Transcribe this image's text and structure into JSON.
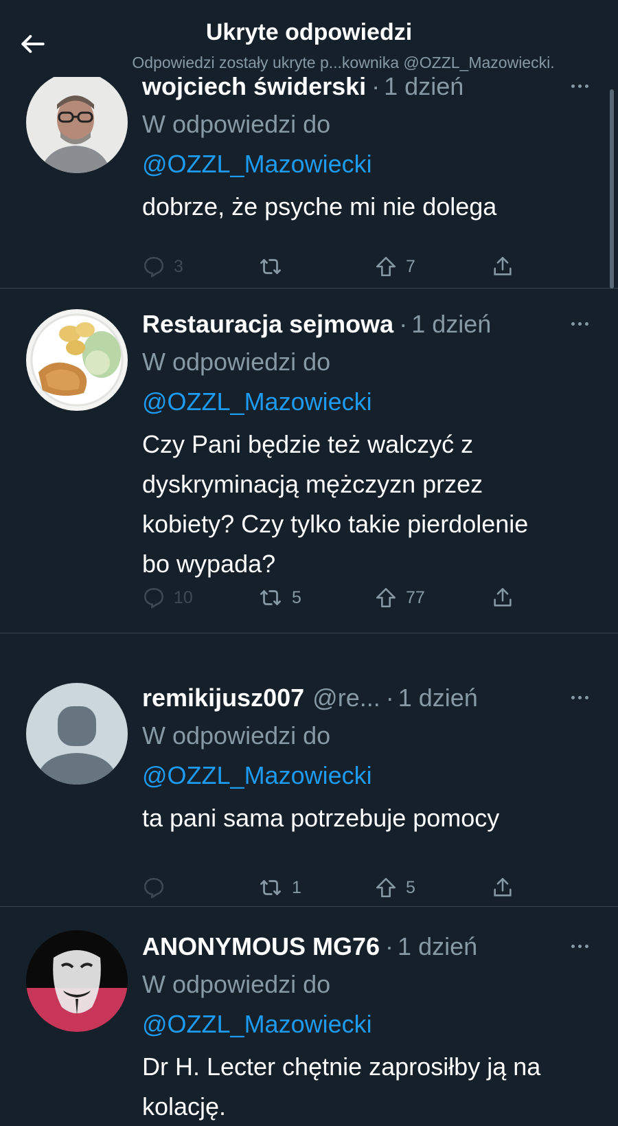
{
  "header": {
    "title": "Ukryte odpowiedzi",
    "subtitle": "Odpowiedzi zostały ukryte p...kownika @OZZL_Mazowiecki."
  },
  "tweets": [
    {
      "name": "wojciech świderski",
      "handle": "",
      "time": "1 dzień",
      "reply_label": "W odpowiedzi do",
      "reply_to": "@OZZL_Mazowiecki",
      "text": "dobrze, że psyche mi nie dolega",
      "replies": "3",
      "retweets": "",
      "likes": "7",
      "avatar_icon": "person-glasses-avatar"
    },
    {
      "name": "Restauracja sejmowa",
      "handle": "",
      "time": "1 dzień",
      "reply_label": "W odpowiedzi do",
      "reply_to": "@OZZL_Mazowiecki",
      "text": "Czy Pani będzie też walczyć z dyskryminacją mężczyzn przez kobiety? Czy tylko takie pierdolenie bo wypada?",
      "replies": "10",
      "retweets": "5",
      "likes": "77",
      "avatar_icon": "food-plate-avatar"
    },
    {
      "name": "remikijusz007",
      "handle": "@re...",
      "time": "1 dzień",
      "reply_label": "W odpowiedzi do",
      "reply_to": "@OZZL_Mazowiecki",
      "text": "ta pani sama potrzebuje pomocy",
      "replies": "",
      "retweets": "1",
      "likes": "5",
      "avatar_icon": "default-user-avatar"
    },
    {
      "name": "ANONYMOUS MG76",
      "handle": "",
      "time": "1 dzień",
      "reply_label": "W odpowiedzi do",
      "reply_to": "@OZZL_Mazowiecki",
      "text": "Dr H. Lecter chętnie  zaprosiłby ją na kolację.",
      "replies": "",
      "retweets": "",
      "likes": "",
      "avatar_icon": "mask-avatar"
    }
  ],
  "colors": {
    "background": "#15202b",
    "secondary_text": "#8899a6",
    "link": "#1d9bf0",
    "divider": "#38444d"
  }
}
